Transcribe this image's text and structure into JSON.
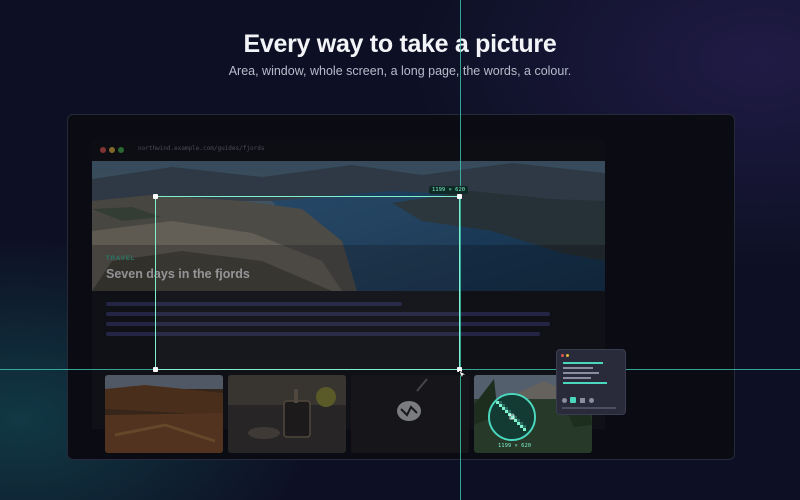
{
  "header": {
    "title": "Every way to take a picture",
    "subtitle": "Area, window, whole screen, a long page, the words, a colour."
  },
  "browser": {
    "url": "northwind.example.com/guides/fjords"
  },
  "article": {
    "tag": "TRAVEL",
    "title": "Seven days in the fjords"
  },
  "capture": {
    "selection_size": "1199 × 620",
    "cursor_readout": "1199 × 620"
  },
  "colors": {
    "accent": "#7ff0cc",
    "guide": "#3fc9b4",
    "tag": "#3fd3b0",
    "background": "#0d1024"
  },
  "icons": [
    "cursor-icon",
    "settings-icon",
    "grid-icon",
    "close-icon",
    "pin-icon"
  ]
}
